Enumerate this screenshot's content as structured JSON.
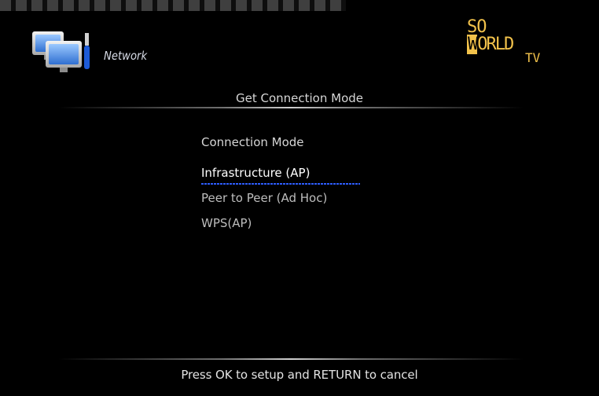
{
  "header": {
    "section_title": "Network",
    "brand": {
      "line1": "SO",
      "line2_w": "W",
      "line2_rest": "ORLD",
      "line3": "TV",
      "color": "#f2c24b"
    }
  },
  "dialog": {
    "title": "Get Connection Mode",
    "label": "Connection Mode",
    "items": [
      {
        "label": "Infrastructure (AP)",
        "selected": true
      },
      {
        "label": "Peer to Peer (Ad Hoc)",
        "selected": false
      },
      {
        "label": "WPS(AP)",
        "selected": false
      }
    ],
    "footer_hint": "Press OK to setup and RETURN to cancel"
  },
  "colors": {
    "background": "#000000",
    "selection_underline": "#2d5dff",
    "text_primary": "#ffffff",
    "text_secondary": "#bdbdbd"
  },
  "icons": {
    "network": "network-computers-icon"
  }
}
